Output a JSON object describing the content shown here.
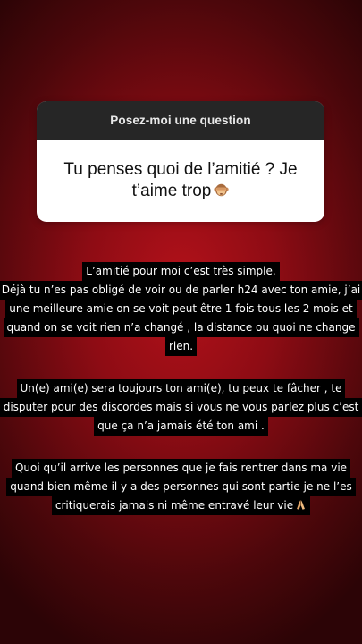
{
  "question_sticker": {
    "header": "Posez-moi une question",
    "question": "Tu penses quoi de l’amitié ? Je t’aime trop",
    "question_line1": "Tu penses quoi de l’amitié ? Je",
    "question_line2": "t’aime trop",
    "emoji": "see-no-evil-monkey-icon"
  },
  "answer": {
    "paragraph1": [
      "L’amitié pour moi c’est très simple.",
      "Déjà tu n’es pas obligé de voir ou de parler h24 avec ton amie, j’ai",
      "une meilleure amie on se voit peut être 1 fois tous les 2 mois et",
      "quand on se voit rien n’a changé , la distance ou quoi ne change",
      "rien."
    ],
    "paragraph2": [
      "Un(e) ami(e) sera toujours ton ami(e), tu peux te fâcher , te",
      "disputer pour des discordes mais si vous ne vous parlez plus c’est",
      "que ça n’a jamais été ton ami ."
    ],
    "paragraph3": [
      "Quoi qu’il arrive les personnes que je fais rentrer dans ma vie",
      "quand bien même il y a des personnes qui sont partie je ne l’es",
      "critiquerais jamais ni même entravé leur vie"
    ],
    "end_emoji": "folded-hands-icon"
  },
  "colors": {
    "background_center": "#b3111a",
    "background_edge": "#2c0406",
    "sticker_header": "#262626",
    "text_highlight": "#000000"
  }
}
